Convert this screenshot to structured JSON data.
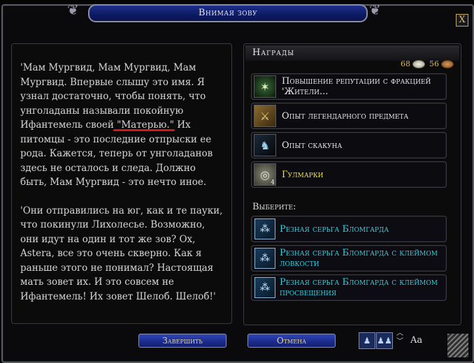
{
  "window": {
    "title": "Внимая зову",
    "close_symbol": "X"
  },
  "quest_text": {
    "paragraph1": "'Мам Мургвид, Мам Мургвид, Мам Мургвид. Впервые слышу это имя. Я узнал достаточно, чтобы понять, что унголаданы называли покойную Ифантемель своей \"Матерью.\" Их питомцы - это последние отпрыски ее рода. Кажется, теперь от унголаданов здесь не осталось и следа. Должно быть, Мам Мургвид - это нечто иное.",
    "paragraph2": "'Они отправились на юг, как и те пауки, что покинули Лихолесье. Возможно, они идут на один и тот же зов? Ох, Astera, все это очень скверно. Как я раньше этого не понимал? Настоящая мать зовет их. И это совсем не Ифантемель! Их зовет Шелоб. Шелоб!'"
  },
  "rewards": {
    "header": "Награды",
    "silver": "68",
    "copper": "56",
    "items": [
      {
        "label": "Повышение репутации с фракцией 'Жители...",
        "icon": "reputation-icon",
        "glyph": "✶"
      },
      {
        "label": "Опыт легендарного предмета",
        "icon": "legendary-item-icon",
        "glyph": "⚔"
      },
      {
        "label": "Опыт скакуна",
        "icon": "horse-icon",
        "glyph": "♞"
      },
      {
        "label": "Гулмарки",
        "icon": "mark-icon",
        "glyph": "◎",
        "badge": "4"
      }
    ],
    "choose_label": "Выберите:",
    "choices": [
      {
        "label": "Резная серьга Бломгарда",
        "icon": "earring-icon"
      },
      {
        "label": "Резная серьга Бломгарда с клеймом ловкости",
        "icon": "earring-icon"
      },
      {
        "label": "Резная серьга Бломгарда с клеймом просвещения",
        "icon": "earring-icon"
      }
    ]
  },
  "buttons": {
    "complete": "Завершить",
    "cancel": "Отмена"
  },
  "footer": {
    "font_label": "Aa"
  },
  "colors": {
    "accent_blue": "#1a2b8a",
    "choice_cyan": "#30d0e0",
    "gold": "#e8d890",
    "underline_red": "#d01a1a"
  }
}
